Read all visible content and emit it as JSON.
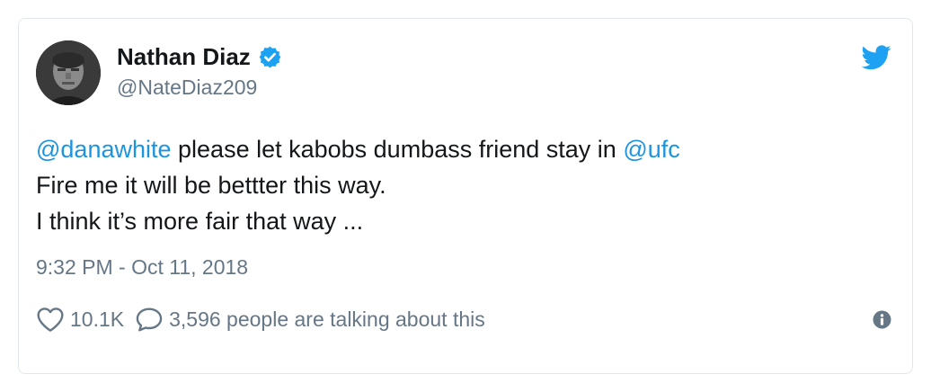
{
  "tweet": {
    "author": {
      "name": "Nathan Diaz",
      "handle": "@NateDiaz209",
      "verified": true
    },
    "text": {
      "line1": {
        "mention1": "@danawhite",
        "middle": " please let kabobs dumbass friend stay in ",
        "mention2": "@ufc"
      },
      "line2": "Fire me it will be bettter this way.",
      "line3": "I think it’s more fair that way ..."
    },
    "timestamp": "9:32 PM - Oct 11, 2018",
    "actions": {
      "likes": "10.1K",
      "talking": "3,596 people are talking about this"
    },
    "icons": {
      "bird": "twitter-bird-icon",
      "verified": "verified-badge-icon",
      "like": "heart-icon",
      "reply": "speech-bubble-icon",
      "info": "info-icon"
    },
    "colors": {
      "accent": "#1b95e0",
      "text": "#14171a",
      "muted": "#657786",
      "border": "#e1e8ed"
    }
  }
}
